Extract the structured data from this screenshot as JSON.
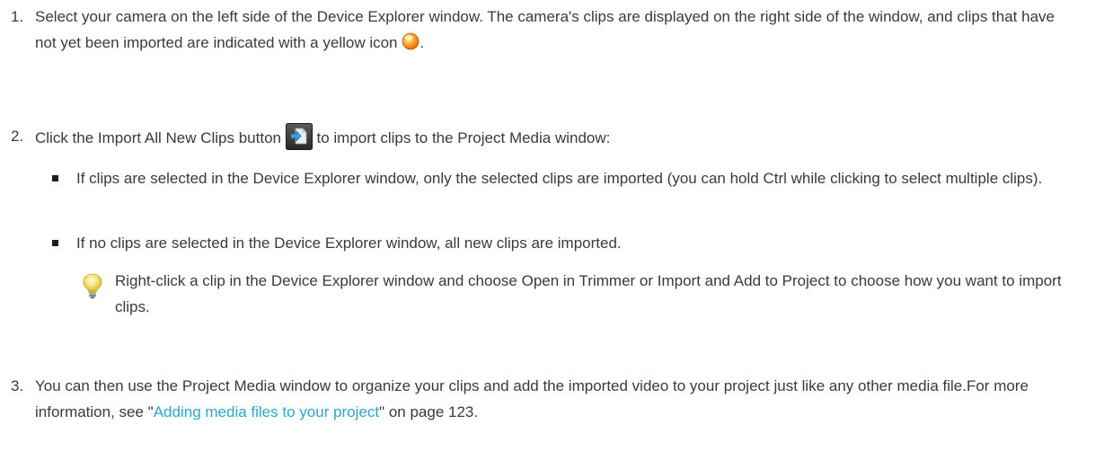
{
  "steps": [
    {
      "number": "1.",
      "text_before_icon": "Select your camera on the left side of the Device Explorer window. The camera's clips are displayed on the right side of the window, and clips that have not yet been imported are indicated with a yellow icon",
      "text_after_icon": ".",
      "icon": "yellow-dot-icon"
    },
    {
      "number": "2.",
      "text_before_icon": "Click the Import All New Clips button",
      "text_after_icon": "to import clips to the Project Media window:",
      "icon": "import-all-new-clips-icon",
      "bullets": [
        "If clips are selected in the Device Explorer window, only the selected clips are imported (you can hold Ctrl while clicking to select multiple clips).",
        "If no clips are selected in the Device Explorer window, all new clips are imported."
      ],
      "tip": {
        "icon": "lightbulb-icon",
        "text": "Right-click a clip in the Device Explorer window and choose Open in Trimmer or Import and Add to Project to choose how you want to import clips."
      }
    },
    {
      "number": "3.",
      "text_before_link": "You can then use the Project Media window to organize your clips and add the imported video to your project just like any other media file.For more information, see \"",
      "link_text": "Adding media files to your project",
      "text_after_link": "\" on page 123."
    }
  ],
  "colors": {
    "text": "#3a3a3a",
    "link": "#2aa7c9",
    "bullet": "#1f1f1f",
    "yellow_icon": "#f5a623"
  }
}
